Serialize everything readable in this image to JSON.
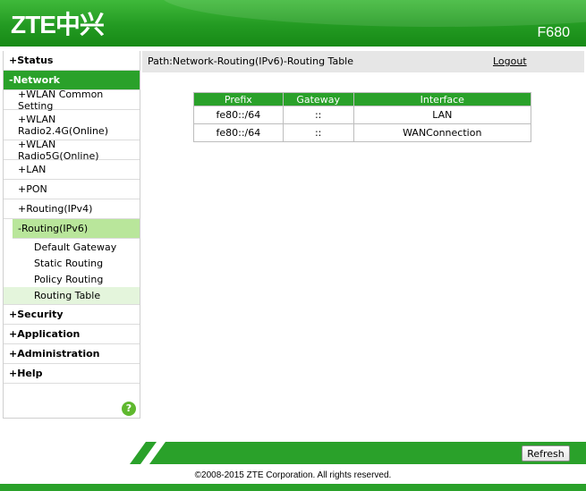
{
  "header": {
    "logo": "ZTE中兴",
    "model": "F680"
  },
  "sidebar": {
    "status": "+Status",
    "network": "-Network",
    "wlan_common": "+WLAN Common Setting",
    "wlan_24": "+WLAN Radio2.4G(Online)",
    "wlan_5": "+WLAN Radio5G(Online)",
    "lan": "+LAN",
    "pon": "+PON",
    "routing_ipv4": "+Routing(IPv4)",
    "routing_ipv6": "-Routing(IPv6)",
    "default_gateway": "Default Gateway",
    "static_routing": "Static Routing",
    "policy_routing": "Policy Routing",
    "routing_table": "Routing Table",
    "security": "+Security",
    "application": "+Application",
    "administration": "+Administration",
    "help": "+Help",
    "help_icon": "?"
  },
  "path": {
    "text": "Path:Network-Routing(IPv6)-Routing Table",
    "logout": "Logout"
  },
  "table": {
    "headers": [
      "Prefix",
      "Gateway",
      "Interface"
    ],
    "rows": [
      [
        "fe80::/64",
        "::",
        "LAN"
      ],
      [
        "fe80::/64",
        "::",
        "WANConnection"
      ]
    ]
  },
  "footer": {
    "refresh": "Refresh",
    "copyright": "©2008-2015 ZTE Corporation. All rights reserved."
  },
  "colors": {
    "brand_green": "#2aa12a",
    "active_sub": "#b9e69b",
    "active_subsub": "#e4f5dc"
  }
}
